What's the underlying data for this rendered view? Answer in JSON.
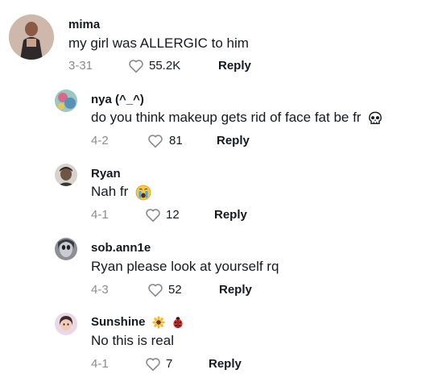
{
  "comments": [
    {
      "username": "mima",
      "text": "my girl was ALLERGIC to him",
      "date": "3-31",
      "likes": "55.2K",
      "reply": "Reply",
      "avatar_icon": "avatar-photo"
    },
    {
      "username": "nya (^_^)",
      "text": "do you think makeup gets rid of face fat be fr",
      "text_emoji": "skull-icon",
      "date": "4-2",
      "likes": "81",
      "reply": "Reply",
      "avatar_icon": "avatar-photo"
    },
    {
      "username": "Ryan",
      "text": "Nah fr",
      "text_emoji": "crying-face-icon",
      "date": "4-1",
      "likes": "12",
      "reply": "Reply",
      "avatar_icon": "avatar-photo"
    },
    {
      "username": "sob.ann1e",
      "text": "Ryan please look at yourself rq",
      "date": "4-3",
      "likes": "52",
      "reply": "Reply",
      "avatar_icon": "avatar-photo"
    },
    {
      "username": "Sunshine",
      "username_emoji": [
        "sunflower-icon",
        "ladybug-icon"
      ],
      "text": "No this is real",
      "date": "4-1",
      "likes": "7",
      "reply": "Reply",
      "avatar_icon": "avatar-photo"
    }
  ],
  "colors": {
    "text": "#161823",
    "meta": "#8a8b91",
    "background": "#ffffff"
  }
}
